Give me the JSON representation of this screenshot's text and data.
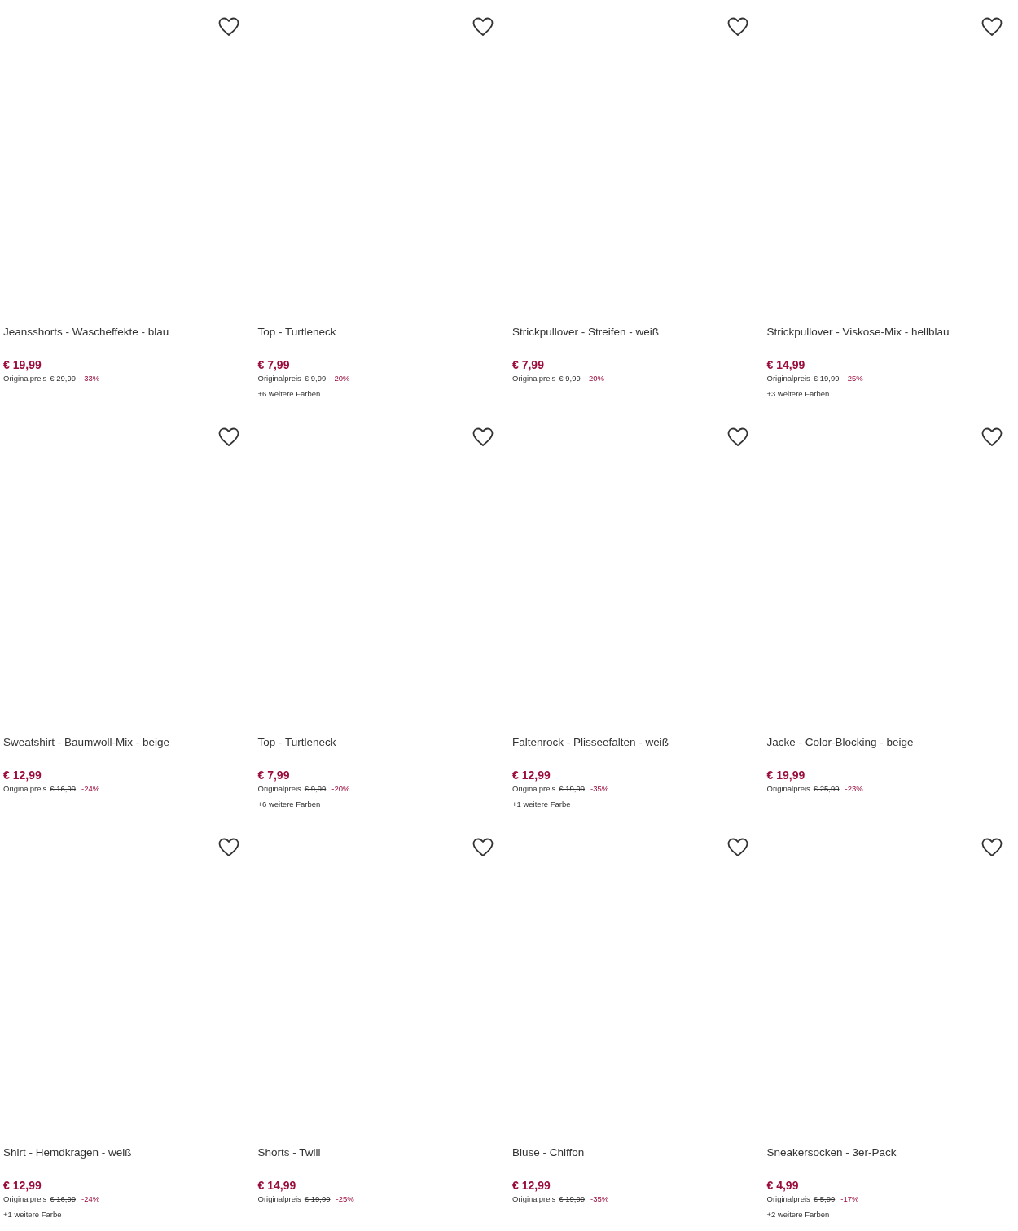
{
  "products": [
    {
      "title": "Jeansshorts - Wascheffekte - blau",
      "price": "€ 19,99",
      "original_label": "Originalpreis",
      "original_price": "€ 29,99",
      "discount": "-33%",
      "wishlisted": false
    },
    {
      "title": "Top - Turtleneck",
      "price": "€ 7,99",
      "original_label": "Originalpreis",
      "original_price": "€ 9,99",
      "discount": "-20%",
      "colors": "+6 weitere Farben",
      "wishlisted": false
    },
    {
      "title": "Strickpullover - Streifen - weiß",
      "price": "€ 7,99",
      "original_label": "Originalpreis",
      "original_price": "€ 9,99",
      "discount": "-20%",
      "wishlisted": false
    },
    {
      "title": "Strickpullover - Viskose-Mix - hellblau",
      "price": "€ 14,99",
      "original_label": "Originalpreis",
      "original_price": "€ 19,99",
      "discount": "-25%",
      "colors": "+3 weitere Farben",
      "wishlisted": false
    },
    {
      "title": "Sweatshirt - Baumwoll-Mix - beige",
      "price": "€ 12,99",
      "original_label": "Originalpreis",
      "original_price": "€ 16,99",
      "discount": "-24%",
      "wishlisted": false
    },
    {
      "title": "Top - Turtleneck",
      "price": "€ 7,99",
      "original_label": "Originalpreis",
      "original_price": "€ 9,99",
      "discount": "-20%",
      "colors": "+6 weitere Farben",
      "wishlisted": false
    },
    {
      "title": "Faltenrock - Plisseefalten - weiß",
      "price": "€ 12,99",
      "original_label": "Originalpreis",
      "original_price": "€ 19,99",
      "discount": "-35%",
      "colors": "+1 weitere Farbe",
      "wishlisted": false
    },
    {
      "title": "Jacke - Color-Blocking - beige",
      "price": "€ 19,99",
      "original_label": "Originalpreis",
      "original_price": "€ 25,99",
      "discount": "-23%",
      "wishlisted": false
    },
    {
      "title": "Shirt - Hemdkragen - weiß",
      "price": "€ 12,99",
      "original_label": "Originalpreis",
      "original_price": "€ 16,99",
      "discount": "-24%",
      "colors": "+1 weitere Farbe",
      "wishlisted": false
    },
    {
      "title": "Shorts - Twill",
      "price": "€ 14,99",
      "original_label": "Originalpreis",
      "original_price": "€ 19,99",
      "discount": "-25%",
      "wishlisted": false
    },
    {
      "title": "Bluse - Chiffon",
      "price": "€ 12,99",
      "original_label": "Originalpreis",
      "original_price": "€ 19,99",
      "discount": "-35%",
      "wishlisted": false
    },
    {
      "title": "Sneakersocken - 3er-Pack",
      "price": "€ 4,99",
      "original_label": "Originalpreis",
      "original_price": "€ 5,99",
      "discount": "-17%",
      "colors": "+2 weitere Farben",
      "wishlisted": false
    }
  ]
}
